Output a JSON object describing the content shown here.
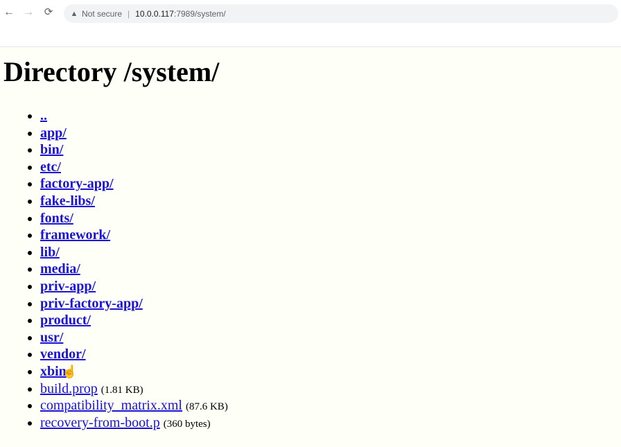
{
  "browser": {
    "nav": {
      "back": "←",
      "forward": "→",
      "reload": "⟳"
    },
    "security_icon": "warning-triangle-icon",
    "security_label": "Not secure",
    "separator": "|",
    "url_host": "10.0.0.117",
    "url_path": ":7989/system/"
  },
  "page": {
    "title": "Directory /system/",
    "entries": [
      {
        "name": "..",
        "kind": "dir",
        "size": ""
      },
      {
        "name": "app/",
        "kind": "dir",
        "size": ""
      },
      {
        "name": "bin/",
        "kind": "dir",
        "size": ""
      },
      {
        "name": "etc/",
        "kind": "dir",
        "size": ""
      },
      {
        "name": "factory-app/",
        "kind": "dir",
        "size": ""
      },
      {
        "name": "fake-libs/",
        "kind": "dir",
        "size": ""
      },
      {
        "name": "fonts/",
        "kind": "dir",
        "size": ""
      },
      {
        "name": "framework/",
        "kind": "dir",
        "size": ""
      },
      {
        "name": "lib/",
        "kind": "dir",
        "size": ""
      },
      {
        "name": "media/",
        "kind": "dir",
        "size": ""
      },
      {
        "name": "priv-app/",
        "kind": "dir",
        "size": ""
      },
      {
        "name": "priv-factory-app/",
        "kind": "dir",
        "size": ""
      },
      {
        "name": "product/",
        "kind": "dir",
        "size": ""
      },
      {
        "name": "usr/",
        "kind": "dir",
        "size": ""
      },
      {
        "name": "vendor/",
        "kind": "dir",
        "size": ""
      },
      {
        "name": "xbin",
        "kind": "dir",
        "size": ""
      },
      {
        "name": "build.prop",
        "kind": "file",
        "size": "(1.81 KB)"
      },
      {
        "name": "compatibility_matrix.xml",
        "kind": "file",
        "size": "(87.6 KB)"
      },
      {
        "name": "recovery-from-boot.p",
        "kind": "file",
        "size": "(360 bytes)"
      }
    ]
  },
  "cursor": {
    "icon": "hand-pointer-icon",
    "glyph": "☝"
  }
}
